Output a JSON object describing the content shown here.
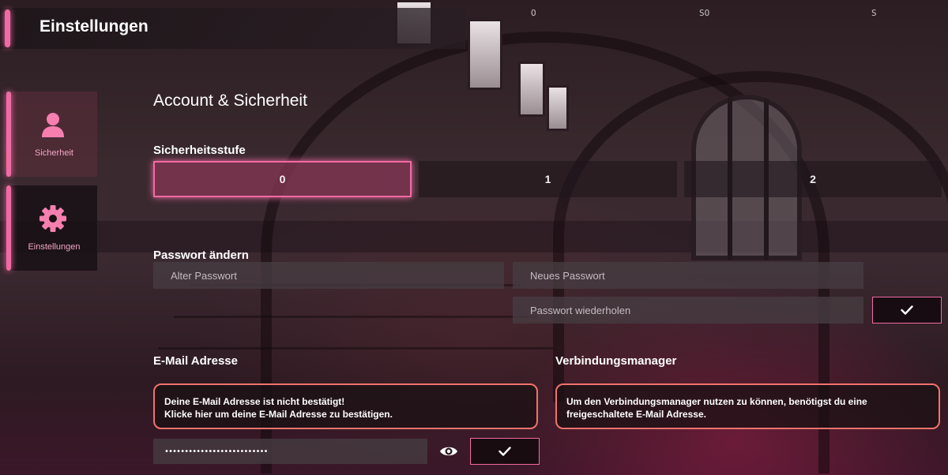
{
  "window": {
    "title": "Einstellungen"
  },
  "compass": [
    "O",
    "SO",
    "S"
  ],
  "nav": {
    "items": [
      {
        "label": "Sicherheit",
        "icon": "user-icon",
        "active": true
      },
      {
        "label": "Einstellungen",
        "icon": "gear-icon",
        "active": false
      }
    ]
  },
  "main": {
    "heading": "Account & Sicherheit",
    "security_level": {
      "label": "Sicherheitsstufe",
      "options": [
        "0",
        "1",
        "2"
      ],
      "selected": "0"
    },
    "password": {
      "label": "Passwort ändern",
      "old_placeholder": "Alter Passwort",
      "new_placeholder": "Neues Passwort",
      "repeat_placeholder": "Passwort wiederholen",
      "confirm_icon": "check-icon"
    },
    "email": {
      "label": "E-Mail Adresse",
      "notice_line1": "Deine E-Mail Adresse ist nicht bestätigt!",
      "notice_line2": "Klicke hier um deine E-Mail Adresse zu bestätigen.",
      "masked_value": "••••••••••••••••••••••••••",
      "reveal_icon": "eye-icon",
      "confirm_icon": "check-icon"
    },
    "connection_manager": {
      "label": "Verbindungsmanager",
      "notice_line1": "Um den Verbindungsmanager nutzen zu können, benötigst du eine",
      "notice_line2": "freigeschaltete E-Mail Adresse."
    }
  },
  "colors": {
    "accent": "#f06aa3",
    "notice_border": "#f0736b",
    "active_segment": "#87375a"
  }
}
